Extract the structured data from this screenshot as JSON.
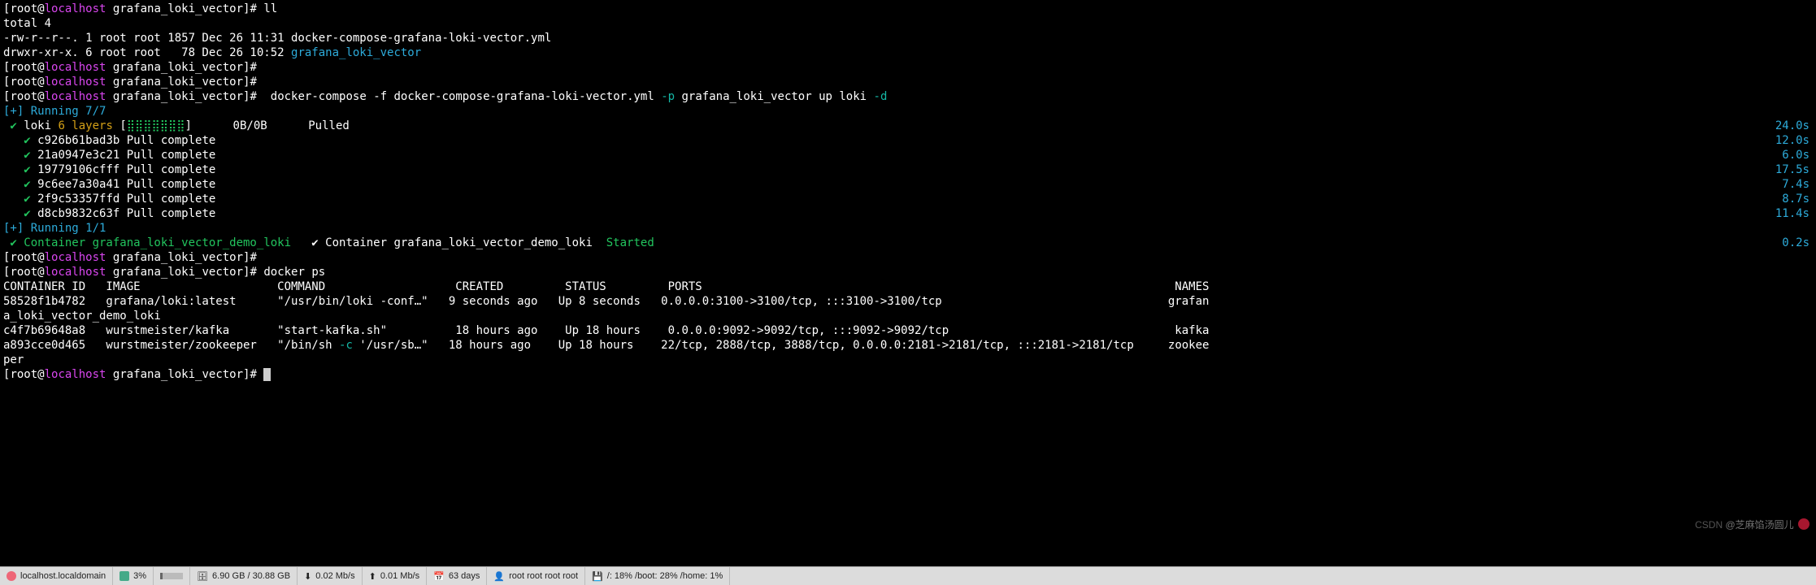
{
  "prompt": {
    "user": "root",
    "at": "@",
    "host": "localhost",
    "sep1": " ",
    "path": "grafana_loki_vector",
    "suffix": "]# "
  },
  "cmd": {
    "ll": "ll",
    "compose": " docker-compose -f docker-compose-grafana-loki-vector.yml ",
    "p_flag": "-p",
    "p_val": " grafana_loki_vector up loki ",
    "d_flag": "-d",
    "dockerps": "docker ps"
  },
  "ll": {
    "total": "total 4",
    "file_perm": "-rw-r--r--. 1 root root 1857 Dec 26 11:31 docker-compose-grafana-loki-vector.yml",
    "dir_perm": "drwxr-xr-x. 6 root root   78 Dec 26 10:52 ",
    "dir_name": "grafana_loki_vector"
  },
  "run1": {
    "header": "[+] Running 7/7",
    "loki_pre": " ✔ ",
    "loki_name": "loki ",
    "loki_layers": "6 layers",
    "loki_bar": " [",
    "loki_fill": "⣿⣿⣿⣿⣿⣿⣿",
    "loki_close": "]      0B/0B      Pulled",
    "loki_t": "24.0s",
    "l1": "   ✔ c926b61bad3b Pull complete",
    "t1": "12.0s",
    "l2": "   ✔ 21a0947e3c21 Pull complete",
    "t2": "6.0s",
    "l3": "   ✔ 19779106cfff Pull complete",
    "t3": "17.5s",
    "l4": "   ✔ 9c6ee7a30a41 Pull complete",
    "t4": "7.4s",
    "l5": "   ✔ 2f9c53357ffd Pull complete",
    "t5": "8.7s",
    "l6": "   ✔ d8cb9832c63f Pull complete",
    "t6": "11.4s"
  },
  "run2": {
    "header": "[+] Running 1/1",
    "c_pre": " ✔ Container grafana_loki_vector_demo_loki  ",
    "c_status": "Started",
    "c_t": "0.2s"
  },
  "ps": {
    "hdr": "CONTAINER ID   IMAGE                    COMMAND                   CREATED         STATUS         PORTS                                                                     NAMES",
    "r1": "58528f1b4782   grafana/loki:latest      \"/usr/bin/loki -conf…\"   9 seconds ago   Up 8 seconds   0.0.0.0:3100->3100/tcp, :::3100->3100/tcp                                 grafan",
    "r1b": "a_loki_vector_demo_loki",
    "r2": "c4f7b69648a8   wurstmeister/kafka       \"start-kafka.sh\"          18 hours ago    Up 18 hours    0.0.0.0:9092->9092/tcp, :::9092->9092/tcp                                 kafka",
    "r3a": "a893cce0d465   wurstmeister/zookeeper   \"/bin/sh ",
    "r3b": "-c",
    "r3c": " '/usr/sb…\"   18 hours ago    Up 18 hours    22/tcp, 2888/tcp, 3888/tcp, 0.0.0.0:2181->2181/tcp, :::2181->2181/tcp     zookee",
    "r3d": "per"
  },
  "watermark": {
    "a": "CSDN",
    "b": " @芝麻馅汤圆儿"
  },
  "taskbar": {
    "host": "localhost.localdomain",
    "cpu": "3%",
    "mem": "6.90 GB / 30.88 GB",
    "down": "0.02 Mb/s",
    "up": "0.01 Mb/s",
    "uptime": "63 days",
    "users": "root  root  root  root",
    "fs": "/: 18%   /boot: 28%   /home: 1%"
  }
}
